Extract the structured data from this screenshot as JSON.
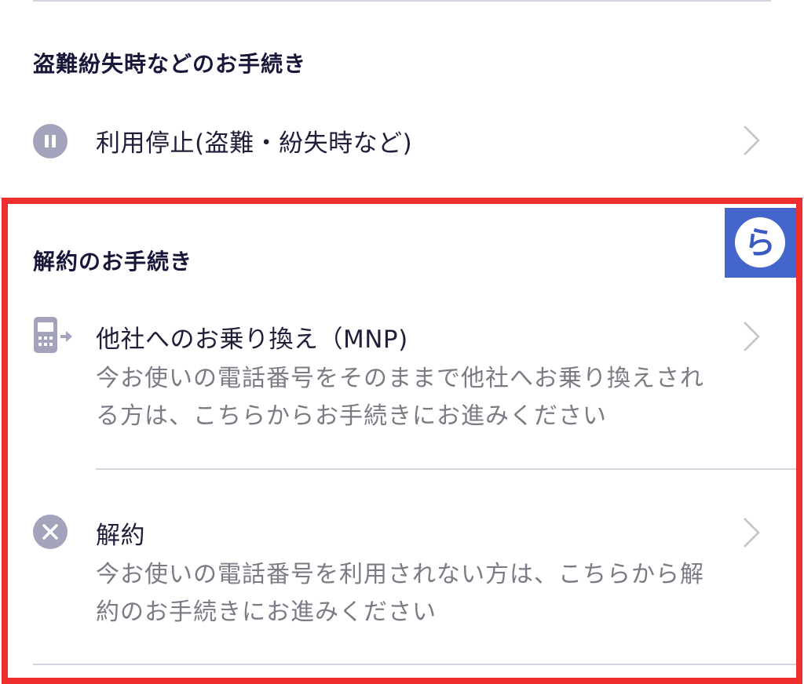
{
  "theft_section": {
    "heading": "盗難紛失時などのお手続き",
    "items": [
      {
        "label": "利用停止(盗難・紛失時など)",
        "icon": "pause-icon"
      }
    ]
  },
  "cancel_section": {
    "heading": "解約のお手続き",
    "items": [
      {
        "label": "他社へのお乗り換え（MNP)",
        "description": "今お使いの電話番号をそのままで他社へお乗り換えされる方は、こちらからお手続きにお進みください",
        "icon": "phone-transfer-icon"
      },
      {
        "label": "解約",
        "description": "今お使いの電話番号を利用されない方は、こちらから解約のお手続きにお進みください",
        "icon": "cancel-x-icon"
      }
    ]
  },
  "badge": {
    "glyph": "ら",
    "color": "#4466cc"
  },
  "colors": {
    "highlight": "#ee2e2e",
    "icon_gray": "#a3a3bb",
    "heading": "#17173a",
    "description": "#7b7b85",
    "divider": "#d4d4de"
  }
}
